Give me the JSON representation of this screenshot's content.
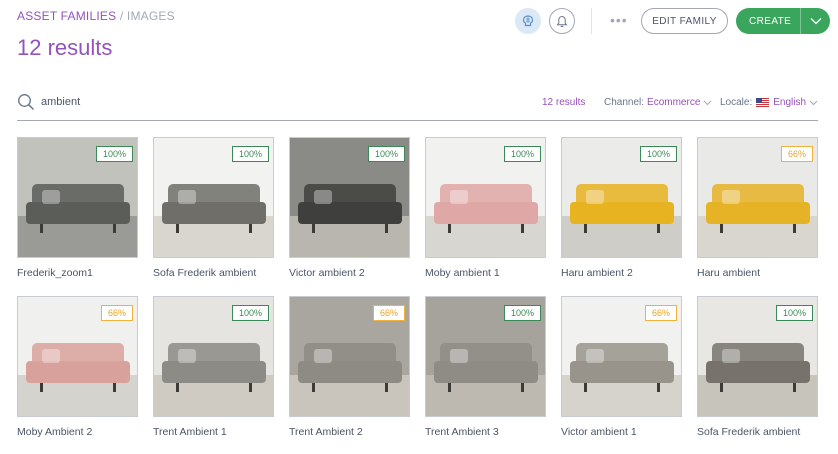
{
  "breadcrumb": {
    "parent": "ASSET FAMILIES",
    "separator": "/",
    "current": "IMAGES"
  },
  "title": "12 results",
  "header": {
    "edit_label": "EDIT FAMILY",
    "create_label": "CREATE",
    "more_label": "•••"
  },
  "search": {
    "value": "ambient",
    "placeholder": "Search"
  },
  "filters": {
    "result_count": "12 results",
    "channel_label": "Channel:",
    "channel_value": "Ecommerce",
    "locale_label": "Locale:",
    "locale_value": "English"
  },
  "colors": {
    "accent": "#9452ba",
    "create": "#3aa65d",
    "complete": "#3a8a57",
    "incomplete": "#e8a326"
  },
  "assets": [
    {
      "label": "Frederik_zoom1",
      "completeness": "100%",
      "status": "full",
      "sofa": "#5a5d58",
      "bg": "#c2c2bd",
      "floor": "#9a9a96"
    },
    {
      "label": "Sofa Frederik ambient",
      "completeness": "100%",
      "status": "full",
      "sofa": "#6f6e69",
      "bg": "#f2f2f0",
      "floor": "#d8d6cf"
    },
    {
      "label": "Victor ambient 2",
      "completeness": "100%",
      "status": "full",
      "sofa": "#3f403d",
      "bg": "#8a8b86",
      "floor": "#b8b6ae"
    },
    {
      "label": "Moby ambient 1",
      "completeness": "100%",
      "status": "full",
      "sofa": "#dfa7a6",
      "bg": "#f1f1ef",
      "floor": "#d7d6d0"
    },
    {
      "label": "Haru ambient 2",
      "completeness": "100%",
      "status": "full",
      "sofa": "#e8b321",
      "bg": "#ebebe9",
      "floor": "#cfcdc7"
    },
    {
      "label": "Haru ambient",
      "completeness": "66%",
      "status": "partial",
      "sofa": "#e6b326",
      "bg": "#e9e9e7",
      "floor": "#d8d6cf"
    },
    {
      "label": "Moby Ambient 2",
      "completeness": "66%",
      "status": "partial",
      "sofa": "#d9a19b",
      "bg": "#f0f0ee",
      "floor": "#d5d3cd"
    },
    {
      "label": "Trent Ambient 1",
      "completeness": "100%",
      "status": "full",
      "sofa": "#8d8b85",
      "bg": "#e5e4e1",
      "floor": "#cfcbc2"
    },
    {
      "label": "Trent Ambient 2",
      "completeness": "66%",
      "status": "partial",
      "sofa": "#8e8b85",
      "bg": "#a9a6a0",
      "floor": "#c9c5bd"
    },
    {
      "label": "Trent Ambient 3",
      "completeness": "100%",
      "status": "full",
      "sofa": "#8f8c86",
      "bg": "#a6a39d",
      "floor": "#bdb9b1"
    },
    {
      "label": "Victor ambient 1",
      "completeness": "66%",
      "status": "partial",
      "sofa": "#98948b",
      "bg": "#f1f1ef",
      "floor": "#d6d3cc"
    },
    {
      "label": "Sofa Frederik ambient",
      "completeness": "100%",
      "status": "full",
      "sofa": "#77736c",
      "bg": "#e8e7e4",
      "floor": "#c7c4bc"
    }
  ]
}
